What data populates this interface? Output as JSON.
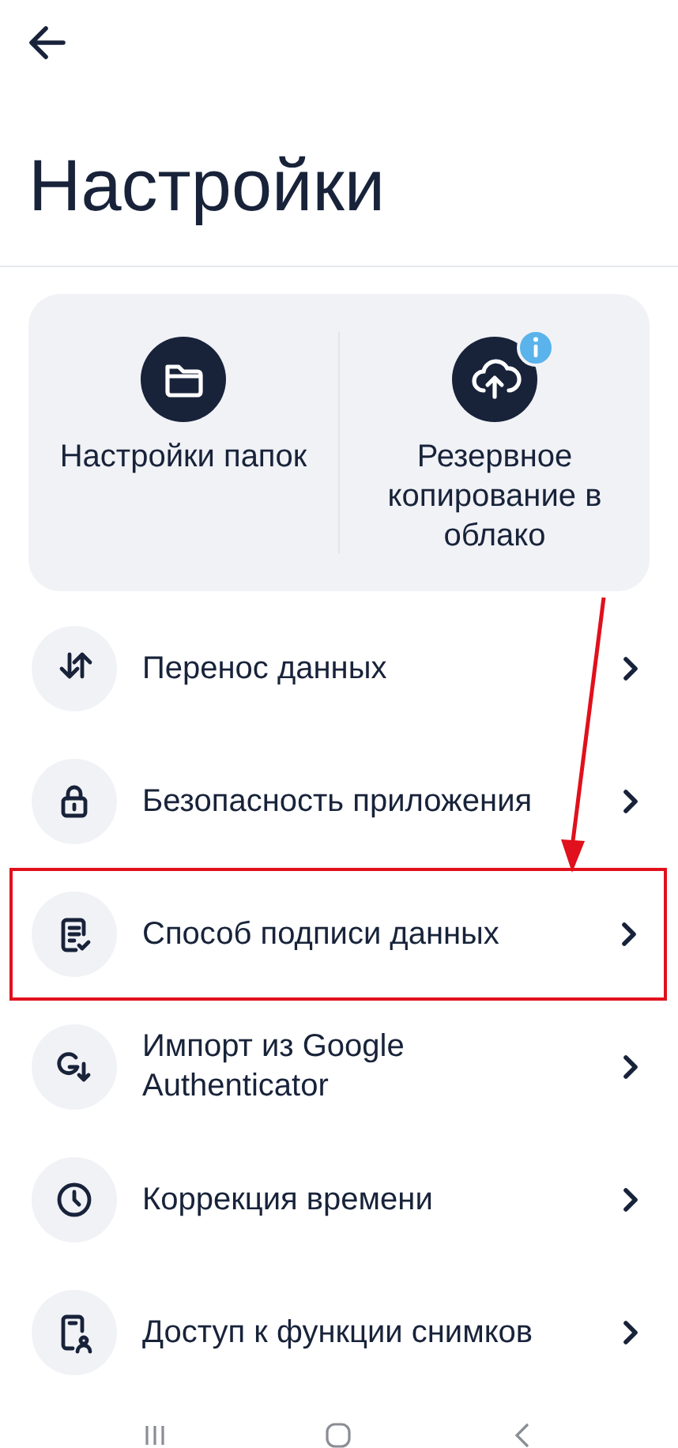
{
  "header": {
    "title": "Настройки"
  },
  "tiles": [
    {
      "label": "Настройки папок",
      "badge": false
    },
    {
      "label": "Резервное копирование в облако",
      "badge": true
    }
  ],
  "items": [
    {
      "label": "Перенос данных",
      "highlighted": false
    },
    {
      "label": "Безопасность приложения",
      "highlighted": false
    },
    {
      "label": "Способ подписи данных",
      "highlighted": true
    },
    {
      "label": "Импорт из Google Authenticator",
      "highlighted": false
    },
    {
      "label": "Коррекция времени",
      "highlighted": false
    },
    {
      "label": "Доступ к функции снимков",
      "highlighted": false
    }
  ]
}
